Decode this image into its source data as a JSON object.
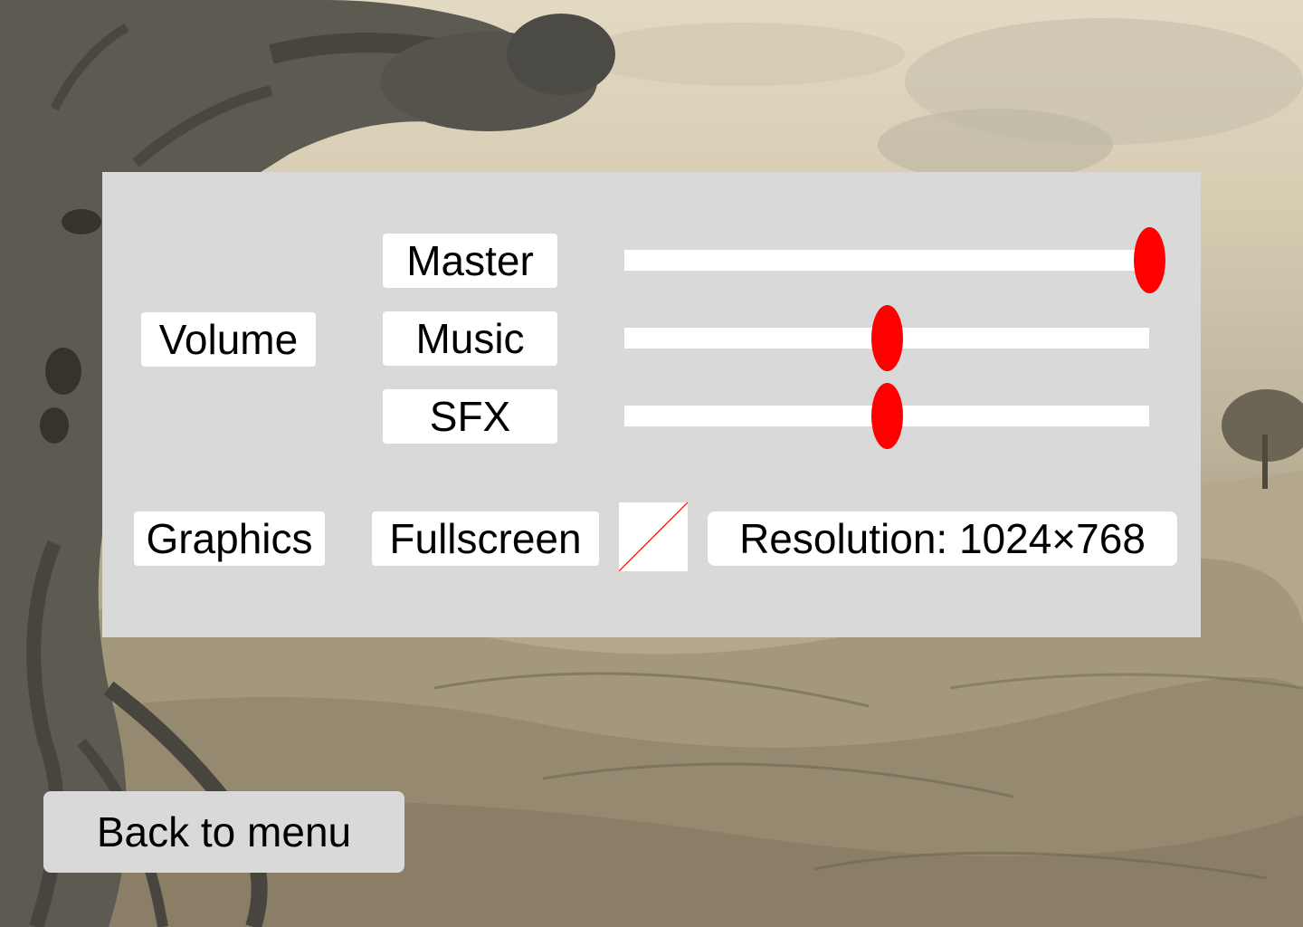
{
  "settings": {
    "volume_label": "Volume",
    "graphics_label": "Graphics",
    "sliders": [
      {
        "label": "Master",
        "value": 1.0
      },
      {
        "label": "Music",
        "value": 0.5
      },
      {
        "label": "SFX",
        "value": 0.5
      }
    ],
    "fullscreen_label": "Fullscreen",
    "fullscreen_checked": false,
    "resolution_text": "Resolution: 1024×768"
  },
  "back_button_label": "Back to menu",
  "colors": {
    "panel": "#d9d9d9",
    "slider_thumb": "#ff0000",
    "checkbox_slash": "#ff0000"
  }
}
